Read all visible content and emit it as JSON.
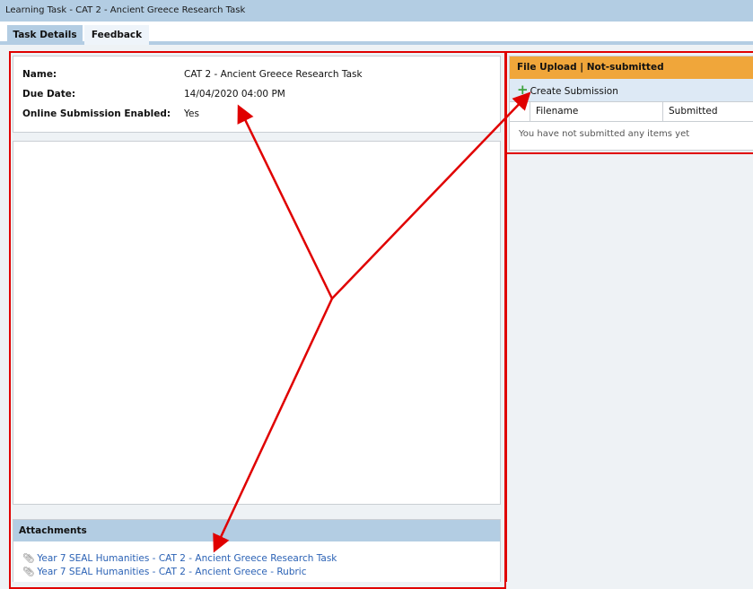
{
  "window": {
    "title": "Learning Task - CAT 2 - Ancient Greece Research Task"
  },
  "tabs": [
    {
      "label": "Task Details",
      "active": true
    },
    {
      "label": "Feedback",
      "active": false
    }
  ],
  "details": {
    "name_label": "Name:",
    "name_value": "CAT 2 - Ancient Greece Research Task",
    "due_label": "Due Date:",
    "due_value": "14/04/2020 04:00 PM",
    "online_label": "Online Submission Enabled:",
    "online_value": "Yes"
  },
  "attachments": {
    "header": "Attachments",
    "items": [
      "Year 7 SEAL Humanities - CAT 2 - Ancient Greece Research Task",
      "Year 7 SEAL Humanities - CAT 2 - Ancient Greece - Rubric"
    ]
  },
  "upload": {
    "header": "File Upload | Not-submitted",
    "create_label": "Create Submission",
    "columns": [
      "Filename",
      "Submitted"
    ],
    "empty_message": "You have not submitted any items yet"
  },
  "colors": {
    "accent": "#b3cde3",
    "upload_header": "#f0a63a",
    "annotation": "#e00000",
    "link": "#2b62b5"
  }
}
